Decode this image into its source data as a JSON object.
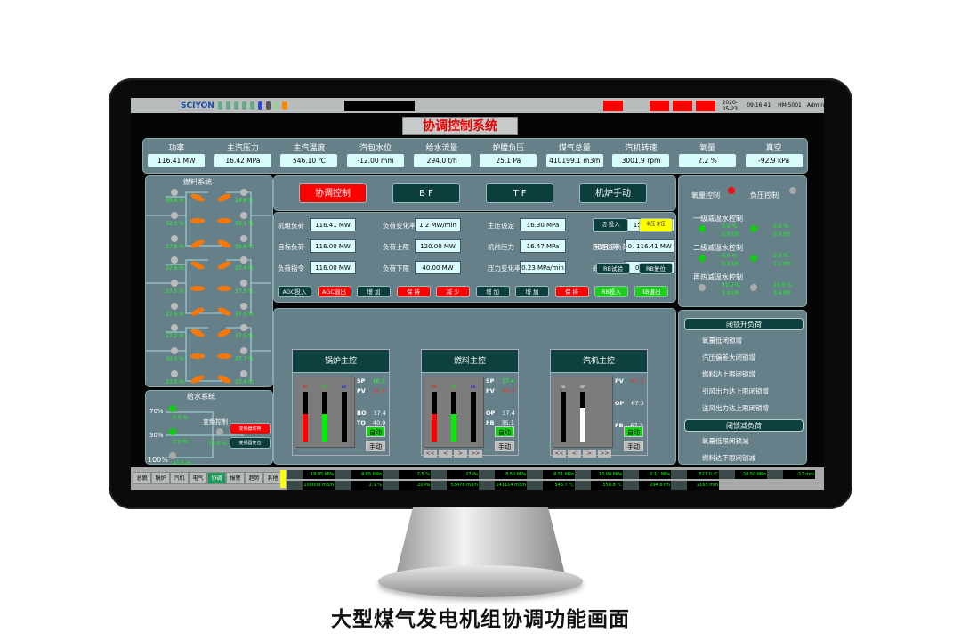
{
  "caption": "大型煤气发电机组协调功能画面",
  "toolbar": {
    "logo": "SCIYON",
    "date": "2020-05-23",
    "time": "09:16:41",
    "station": "HMI5001",
    "user": "Admin",
    "alarms": [
      {
        "color": "#ff0000"
      },
      {
        "color": "#b9bcbc"
      },
      {
        "color": "#ff0000"
      },
      {
        "color": "#ff0000"
      },
      {
        "color": "#ff0000"
      }
    ]
  },
  "title": "协调控制系统",
  "params": [
    {
      "label": "功率",
      "value": "116.41 MW"
    },
    {
      "label": "主汽压力",
      "value": "16.42 MPa"
    },
    {
      "label": "主汽温度",
      "value": "546.10 ℃"
    },
    {
      "label": "汽包水位",
      "value": "-12.00 mm"
    },
    {
      "label": "给水流量",
      "value": "294.0 t/h"
    },
    {
      "label": "炉膛负压",
      "value": "25.1 Pa"
    },
    {
      "label": "煤气总量",
      "value": "410199.1 m3/h"
    },
    {
      "label": "汽机转速",
      "value": "3001.9 rpm"
    },
    {
      "label": "氧量",
      "value": "2.2 %"
    },
    {
      "label": "真空",
      "value": "-92.9 kPa"
    }
  ],
  "modes": [
    {
      "label": "协调控制",
      "color": "#ff0000"
    },
    {
      "label": "B F",
      "color": "#0d3e3e"
    },
    {
      "label": "T F",
      "color": "#0d3e3e"
    },
    {
      "label": "机炉手动",
      "color": "#0d3e3e"
    }
  ],
  "settings": {
    "r1": [
      {
        "label": "机组负荷",
        "value": "116.41 MW"
      },
      {
        "label": "负荷变化率",
        "value": "1.2 MW/min"
      },
      {
        "label": "主压设定",
        "value": "16.30 MPa"
      },
      {
        "label": "阀口设定值",
        "value": "15.83 MPa"
      }
    ],
    "r2": [
      {
        "label": "目标负荷",
        "value": "116.00 MW"
      },
      {
        "label": "负荷上限",
        "value": "120.00 MW"
      },
      {
        "label": "机前压力",
        "value": "16.47 MPa"
      },
      {
        "label": "压力速率",
        "value": "-0.002 MPa/Min"
      }
    ],
    "r3": [
      {
        "label": "负荷指令",
        "value": "116.00 MW"
      },
      {
        "label": "负荷下限",
        "value": "40.00 MW"
      },
      {
        "label": "压力变化率",
        "value": "0.23 MPa/min"
      },
      {
        "label": "阀门偏置",
        "value": "0.47 MPa"
      }
    ],
    "rb_label": "RB目标负荷",
    "rb_value": "116.41 MW",
    "switch_btn": "切 投入",
    "yellow_ind": "滑压 定压",
    "btn_r3a": "RB试验",
    "btn_r3b": "RB复位",
    "buttons": [
      {
        "label": "AGC投入",
        "c": "dk"
      },
      {
        "label": "AGC退出",
        "c": "red"
      },
      {
        "label": "增 加",
        "c": "dk"
      },
      {
        "label": "保 持",
        "c": "red"
      },
      {
        "label": "减 少",
        "c": "red"
      },
      {
        "label": "增 加",
        "c": "dk"
      },
      {
        "label": "增 加",
        "c": "dk"
      },
      {
        "label": "保 持",
        "c": "red"
      },
      {
        "label": "RB投入",
        "c": "gr"
      },
      {
        "label": "RB退出",
        "c": "gr"
      }
    ]
  },
  "controllers": [
    {
      "title": "锅炉主控",
      "rows": [
        [
          "SP",
          "16.3"
        ],
        [
          "PV",
          "16.4"
        ],
        [
          "BO",
          "37.4"
        ],
        [
          "TO",
          "40.9"
        ]
      ],
      "bars": [
        {
          "tag": "PV",
          "level": 0.55,
          "color": "#ff0000"
        },
        {
          "tag": "SP",
          "level": 0.55,
          "color": "#00ee00"
        },
        {
          "tag": "ER",
          "level": 0,
          "color": "#0000ff"
        }
      ],
      "auto": "自动",
      "manual": "手动"
    },
    {
      "title": "燃料主控",
      "rows": [
        [
          "SP",
          "37.4"
        ],
        [
          "PV",
          "40.9"
        ],
        [
          "OP",
          "37.4"
        ],
        [
          "FB",
          "35.1"
        ]
      ],
      "bars": [
        {
          "tag": "PV",
          "level": 0.55,
          "color": "#ff0000"
        },
        {
          "tag": "SP",
          "level": 0.55,
          "color": "#00ee00"
        },
        {
          "tag": "ER",
          "level": 0,
          "color": "#0000ff"
        }
      ],
      "auto": "自动",
      "manual": "手动",
      "nav": [
        "<<",
        "<",
        ">",
        ">>"
      ]
    },
    {
      "title": "汽机主控",
      "rows": [
        [
          "PV",
          "67.3"
        ],
        [
          "OP",
          "67.3"
        ],
        [
          "FB",
          "67.3"
        ]
      ],
      "bars": [
        {
          "tag": "FB",
          "level": 0.67,
          "color": "#000000"
        },
        {
          "tag": "OP",
          "level": 0.67,
          "color": "#ffffff"
        }
      ],
      "auto": "自动",
      "manual": "手动",
      "nav": [
        "<<",
        "<",
        ">",
        ">>"
      ]
    }
  ],
  "fuel": {
    "title": "燃料系统",
    "groups": [
      [
        "59.8 %",
        "32.3 %",
        "37.8 %",
        "29.8 %",
        "50.1 %",
        "39.6 %"
      ],
      [
        "37.6 %",
        "37.5 %",
        "37.5 %",
        "37.4 %",
        "37.5 %",
        "37.5 %"
      ],
      [
        "37.2 %",
        "30.3 %",
        "33.5 %",
        "37.5 %",
        "37.7 %",
        "37.4 %"
      ]
    ]
  },
  "water": {
    "title": "给水系统",
    "labels": [
      "70%",
      "30%",
      "100%"
    ],
    "values": [
      "0.0 %",
      "0.0 %",
      "41.5 %"
    ],
    "vfd_label": "变频控制",
    "vfd_value": "33.5 %",
    "btn1": "变频器切换",
    "btn2": "变频器复位"
  },
  "right": {
    "o2": "氧量控制",
    "draft": "负压控制",
    "groups": [
      {
        "title": "一级减温水控制",
        "vals": [
          "0.0 %",
          "0.0 t/h",
          "0.0 %",
          "0.0 t/h"
        ]
      },
      {
        "title": "二级减温水控制",
        "vals": [
          "0.0 %",
          "0.2 t/h",
          "0.0 %",
          "1.1 t/h"
        ]
      },
      {
        "title": "再热减温水控制",
        "vals": [
          "21.0 %",
          "3.4 t/h",
          "21.0 %",
          "3.4 t/h"
        ]
      }
    ],
    "inc_header": "闭锁升负荷",
    "inc": [
      "氧量低闭锁增",
      "汽压偏差大闭锁增",
      "燃料达上限闭锁增",
      "引风出力达上限闭锁增",
      "送风出力达上限闭锁增"
    ],
    "dec_header": "闭锁减负荷",
    "dec": [
      "氧量低限闭锁减",
      "燃料达下限闭锁减"
    ]
  },
  "bottom": {
    "tabs": [
      "总貌",
      "锅炉",
      "汽机",
      "电气",
      "协调",
      "报警",
      "趋势",
      "其他"
    ],
    "active": "协调",
    "values": [
      "18.05 MPa",
      "8.65 MPa",
      "2.5 %",
      "27 Pa",
      "8.50 MPa",
      "8.51 MPa",
      "16.98 MPa",
      "3.11 MPa",
      "527.0 ℃",
      "20.50 MPa",
      "-11 mm",
      "100000 m3/h",
      "2.1 %",
      "20 Pa",
      "53478 m3/h",
      "141114 m3/h",
      "545.7 ℃",
      "550.8 ℃",
      "294.6 t/h",
      "2165 mm"
    ]
  }
}
